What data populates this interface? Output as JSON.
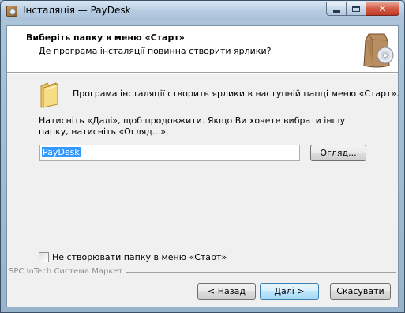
{
  "window": {
    "title": "Інсталяція — PayDesk"
  },
  "header": {
    "title": "Виберіть папку в меню «Старт»",
    "subtitle": "Де програма інсталяції повинна створити ярлики?"
  },
  "body": {
    "info": "Програма інсталяції створить ярлики в наступній папці меню «Старт».",
    "hint": "Натисніть «Далі», щоб продовжити. Якщо Ви хочете вибрати іншу папку, натисніть «Огляд...».",
    "folder_value": "PayDesk",
    "browse_label": "Огляд...",
    "no_folder_label": "Не створювати папку в меню «Старт»",
    "no_folder_checked": false
  },
  "footer": {
    "brand": "SPC InTech Система Маркет",
    "back_label": "< Назад",
    "next_label": "Далі >",
    "cancel_label": "Скасувати"
  },
  "icons": {
    "app": "installer-icon",
    "header": "package-bag-icon",
    "folder": "folder-icon"
  }
}
